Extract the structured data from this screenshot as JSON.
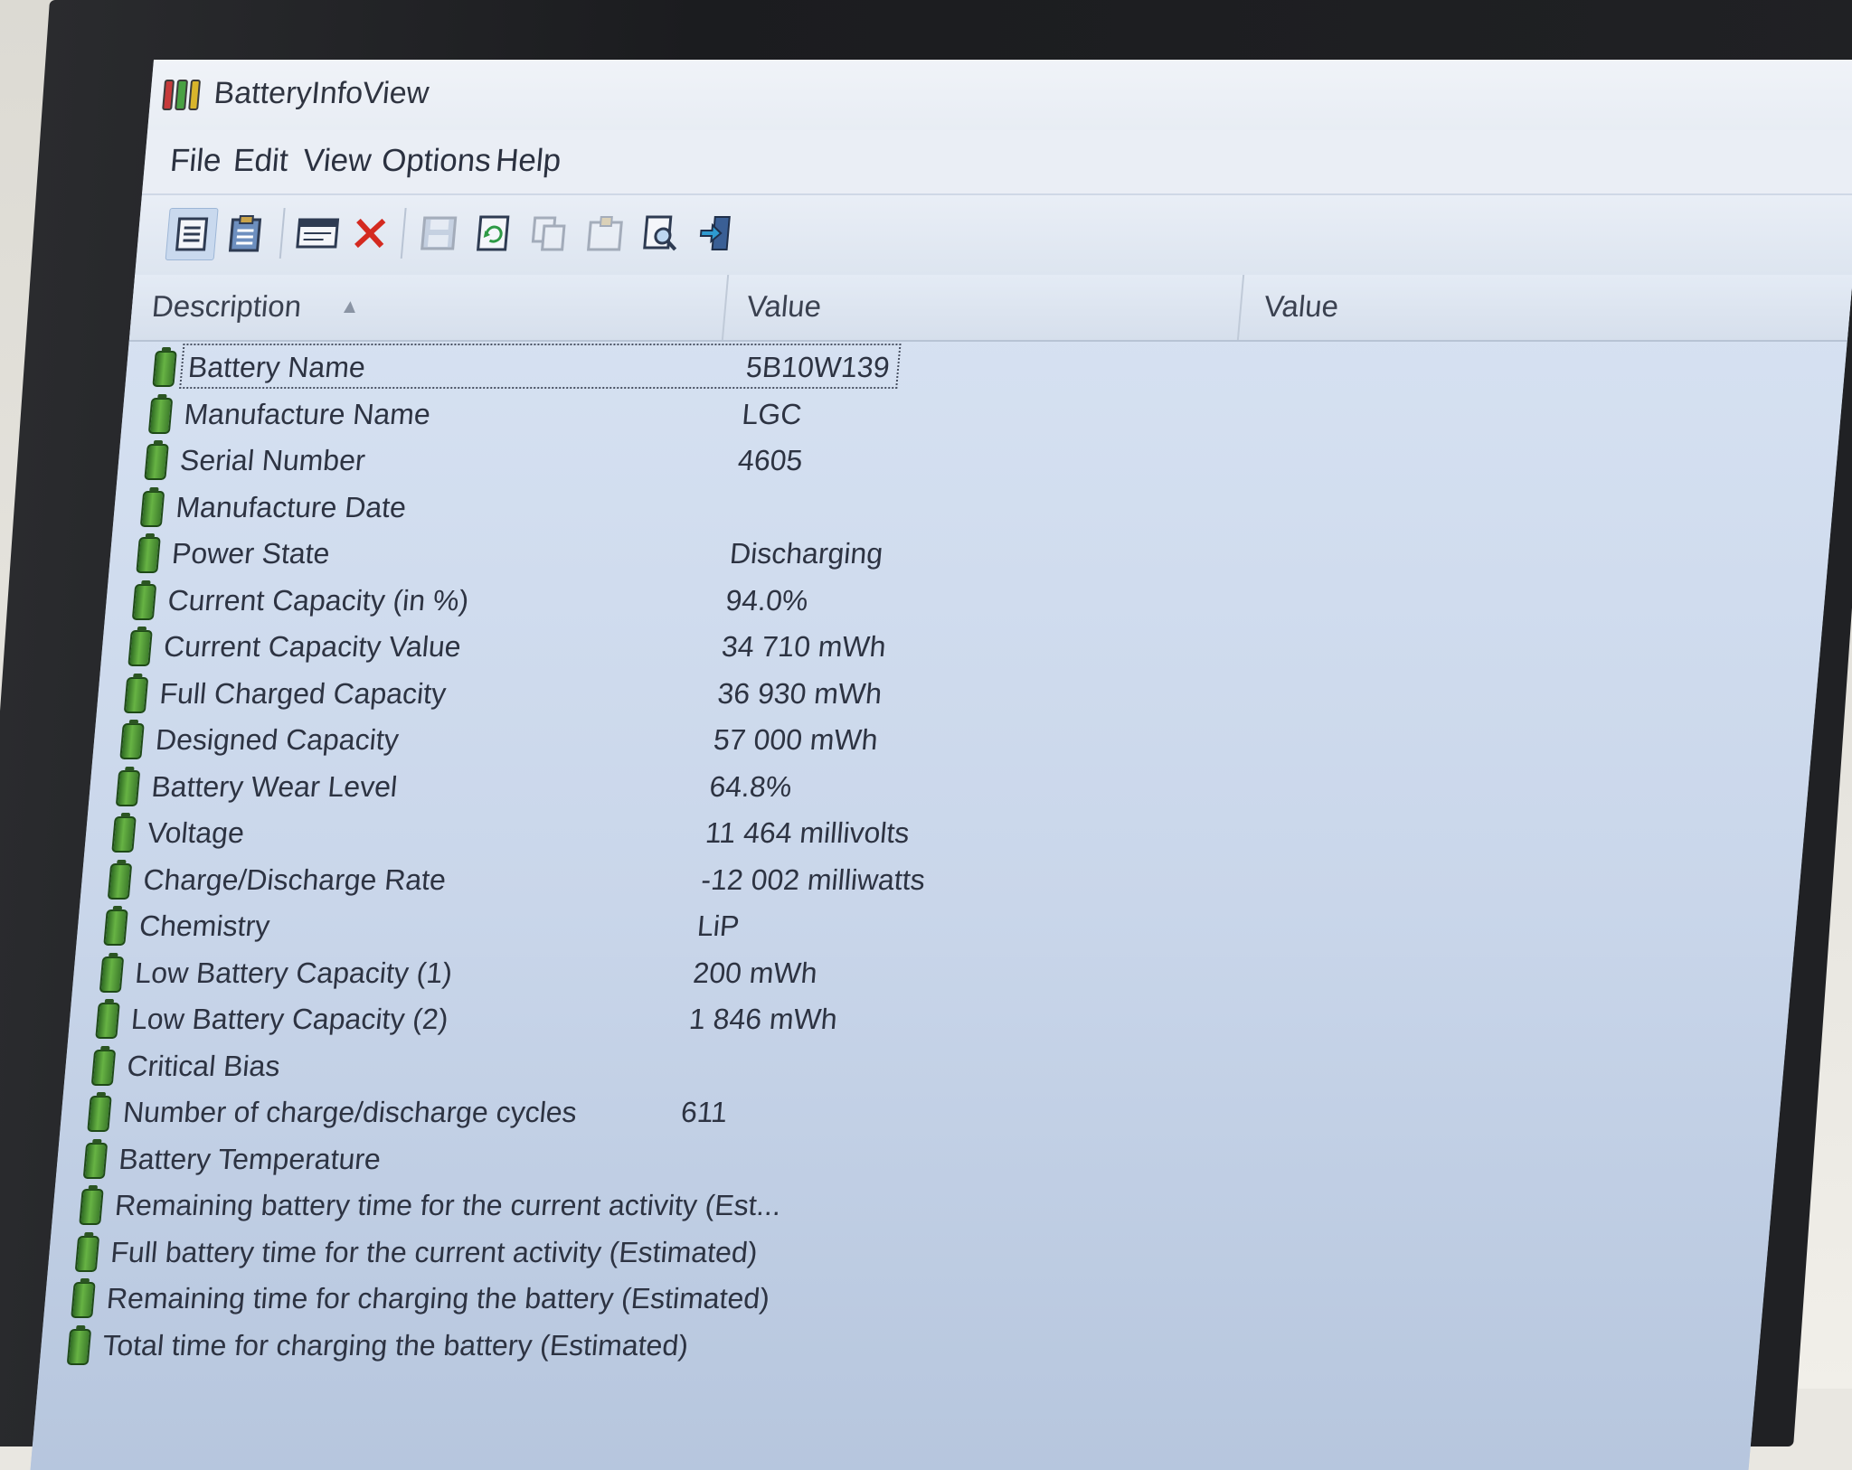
{
  "window": {
    "title": "BatteryInfoView"
  },
  "menu": [
    "File",
    "Edit",
    "View",
    "Options",
    "Help"
  ],
  "toolbar": {
    "buttons": [
      {
        "icon": "view-list-icon",
        "state": "active"
      },
      {
        "icon": "clipboard-icon",
        "state": "enabled"
      },
      {
        "icon": "properties-window-icon",
        "state": "enabled"
      },
      {
        "icon": "delete-icon",
        "state": "enabled"
      },
      {
        "icon": "save-icon",
        "state": "disabled"
      },
      {
        "icon": "refresh-icon",
        "state": "enabled"
      },
      {
        "icon": "copy-icon",
        "state": "disabled"
      },
      {
        "icon": "properties-icon",
        "state": "disabled"
      },
      {
        "icon": "find-icon",
        "state": "enabled"
      },
      {
        "icon": "exit-icon",
        "state": "enabled"
      }
    ]
  },
  "columns": [
    "Description",
    "Value",
    "Value"
  ],
  "rows": [
    {
      "desc": "Battery Name",
      "value": "5B10W139",
      "selected": true
    },
    {
      "desc": "Manufacture Name",
      "value": "LGC"
    },
    {
      "desc": "Serial Number",
      "value": "4605"
    },
    {
      "desc": "Manufacture Date",
      "value": ""
    },
    {
      "desc": "Power State",
      "value": "Discharging"
    },
    {
      "desc": "Current Capacity (in %)",
      "value": "94.0%"
    },
    {
      "desc": "Current Capacity Value",
      "value": "34 710 mWh"
    },
    {
      "desc": "Full Charged Capacity",
      "value": "36 930 mWh"
    },
    {
      "desc": "Designed Capacity",
      "value": "57 000 mWh"
    },
    {
      "desc": "Battery Wear Level",
      "value": "64.8%"
    },
    {
      "desc": "Voltage",
      "value": "11 464 millivolts"
    },
    {
      "desc": "Charge/Discharge Rate",
      "value": "-12 002 milliwatts"
    },
    {
      "desc": "Chemistry",
      "value": "LiP"
    },
    {
      "desc": "Low Battery Capacity (1)",
      "value": "200 mWh"
    },
    {
      "desc": "Low Battery Capacity (2)",
      "value": "1 846 mWh"
    },
    {
      "desc": "Critical Bias",
      "value": ""
    },
    {
      "desc": "Number of charge/discharge cycles",
      "value": "611"
    },
    {
      "desc": "Battery Temperature",
      "value": ""
    },
    {
      "desc": "Remaining battery time for the current activity (Est...",
      "value": ""
    },
    {
      "desc": "Full battery time for the current activity (Estimated)",
      "value": ""
    },
    {
      "desc": "Remaining time for charging the battery (Estimated)",
      "value": ""
    },
    {
      "desc": "Total  time for charging the battery (Estimated)",
      "value": ""
    }
  ],
  "colors": {
    "battery_green": "#67b344",
    "delete_red": "#d42a20"
  }
}
